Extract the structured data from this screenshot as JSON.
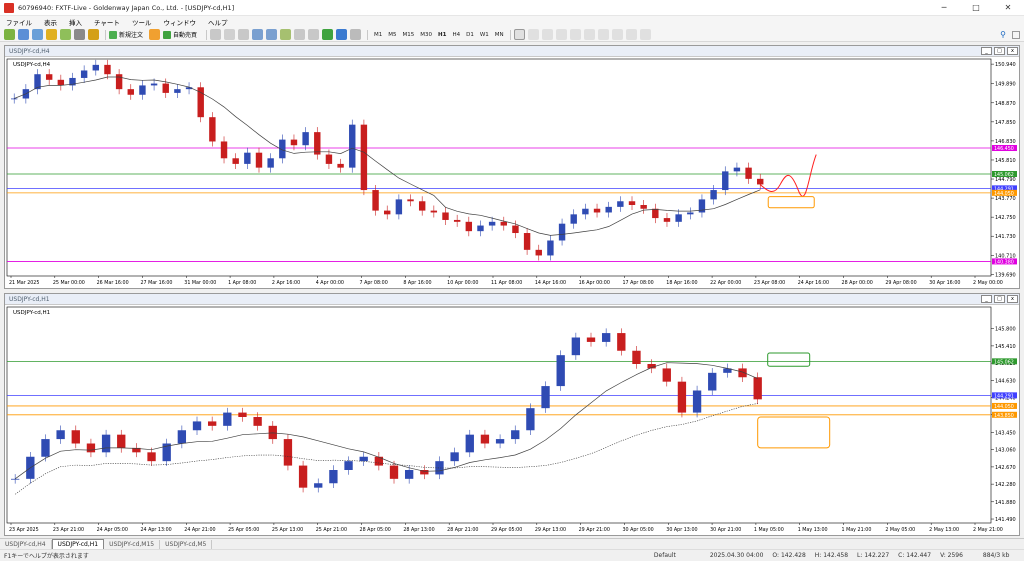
{
  "window": {
    "title": "60796940: FXTF-Live - Goldenway Japan Co., Ltd. - [USDJPY-cd,H1]"
  },
  "menu": [
    "ファイル",
    "表示",
    "挿入",
    "チャート",
    "ツール",
    "ウィンドウ",
    "ヘルプ"
  ],
  "toolbar": {
    "new_order": "新規注文",
    "auto_trade": "自動売買",
    "timeframes": [
      "M1",
      "M5",
      "M15",
      "M30",
      "H1",
      "H4",
      "D1",
      "W1",
      "MN"
    ],
    "active_timeframe": "H1"
  },
  "charts": [
    {
      "title": "USDJPY-cd,H4",
      "label": "USDJPY-cd,H4",
      "price_min": 139.6,
      "price_max": 151.0,
      "ticks": [
        "150.940",
        "149.890",
        "148.870",
        "147.850",
        "146.830",
        "145.810",
        "144.790",
        "143.770",
        "142.750",
        "141.730",
        "140.710",
        "139.690"
      ],
      "tick_values": [
        150.94,
        149.89,
        148.87,
        147.85,
        146.83,
        145.81,
        144.79,
        143.77,
        142.75,
        141.73,
        140.71,
        139.69
      ],
      "dates": [
        "21 Mar 2025",
        "25 Mar 00:00",
        "26 Mar 16:00",
        "27 Mar 16:00",
        "31 Mar 00:00",
        "1 Apr 08:00",
        "2 Apr 16:00",
        "4 Apr 00:00",
        "7 Apr 08:00",
        "8 Apr 16:00",
        "10 Apr 00:00",
        "11 Apr 08:00",
        "14 Apr 16:00",
        "16 Apr 00:00",
        "17 Apr 08:00",
        "18 Apr 16:00",
        "22 Apr 00:00",
        "23 Apr 08:00",
        "24 Apr 16:00",
        "28 Apr 00:00",
        "29 Apr 08:00",
        "30 Apr 16:00",
        "2 May 00:00"
      ],
      "hlines": [
        {
          "value": 146.45,
          "color": "#e000e0",
          "label": "146.450"
        },
        {
          "value": 145.06,
          "color": "#2e9a2e",
          "label": "145.062"
        },
        {
          "value": 144.29,
          "color": "#4040ff",
          "label": "144.291"
        },
        {
          "value": 144.05,
          "color": "#ff9900",
          "label": "144.050"
        },
        {
          "value": 140.38,
          "color": "#e000e0",
          "label": "140.380"
        }
      ],
      "closes": [
        149.1,
        149.6,
        150.4,
        150.1,
        149.8,
        150.2,
        150.6,
        150.9,
        150.4,
        149.6,
        149.3,
        149.8,
        149.9,
        149.4,
        149.6,
        149.7,
        148.1,
        146.8,
        145.9,
        145.6,
        146.2,
        145.4,
        145.9,
        146.9,
        146.6,
        147.3,
        146.1,
        145.6,
        145.4,
        147.7,
        144.2,
        143.1,
        142.9,
        143.7,
        143.6,
        143.1,
        143.0,
        142.6,
        142.5,
        142.0,
        142.3,
        142.5,
        142.3,
        141.9,
        141.0,
        140.7,
        141.5,
        142.4,
        142.9,
        143.2,
        143.0,
        143.3,
        143.6,
        143.4,
        143.2,
        142.7,
        142.5,
        142.9,
        143.0,
        143.7,
        144.2,
        145.2,
        145.4,
        144.8,
        144.5
      ],
      "path_color": "#ff2020",
      "box": {
        "y_hi": 143.85,
        "y_lo": 143.25,
        "color": "#ff9900"
      }
    },
    {
      "title": "USDJPY-cd,H1",
      "label": "USDJPY-cd,H1",
      "price_min": 141.4,
      "price_max": 146.2,
      "ticks": [
        "145.800",
        "145.410",
        "145.020",
        "144.630",
        "144.240",
        "143.850",
        "143.450",
        "143.060",
        "142.670",
        "142.280",
        "141.880",
        "141.490"
      ],
      "tick_values": [
        145.8,
        145.41,
        145.02,
        144.63,
        144.24,
        143.85,
        143.45,
        143.06,
        142.67,
        142.28,
        141.88,
        141.49
      ],
      "dates": [
        "23 Apr 2025",
        "23 Apr 21:00",
        "24 Apr 05:00",
        "24 Apr 13:00",
        "24 Apr 21:00",
        "25 Apr 05:00",
        "25 Apr 13:00",
        "25 Apr 21:00",
        "28 Apr 05:00",
        "28 Apr 13:00",
        "28 Apr 21:00",
        "29 Apr 05:00",
        "29 Apr 13:00",
        "29 Apr 21:00",
        "30 Apr 05:00",
        "30 Apr 13:00",
        "30 Apr 21:00",
        "1 May 05:00",
        "1 May 13:00",
        "1 May 21:00",
        "2 May 05:00",
        "2 May 13:00",
        "2 May 21:00"
      ],
      "hlines": [
        {
          "value": 145.06,
          "color": "#2e9a2e",
          "label": "145.062"
        },
        {
          "value": 144.29,
          "color": "#4040ff",
          "label": "144.291"
        },
        {
          "value": 144.05,
          "color": "#ff9900",
          "label": "144.050"
        },
        {
          "value": 143.85,
          "color": "#ff9900",
          "label": "143.850"
        }
      ],
      "closes": [
        142.4,
        142.9,
        143.3,
        143.5,
        143.2,
        143.0,
        143.4,
        143.1,
        143.0,
        142.8,
        143.2,
        143.5,
        143.7,
        143.6,
        143.9,
        143.8,
        143.6,
        143.3,
        142.7,
        142.2,
        142.3,
        142.6,
        142.8,
        142.9,
        142.7,
        142.4,
        142.6,
        142.5,
        142.8,
        143.0,
        143.4,
        143.2,
        143.3,
        143.5,
        144.0,
        144.5,
        145.2,
        145.6,
        145.5,
        145.7,
        145.3,
        145.0,
        144.9,
        144.6,
        143.9,
        144.4,
        144.8,
        144.9,
        144.7,
        144.2
      ],
      "green_box": {
        "y_hi": 145.25,
        "y_lo": 144.95
      },
      "orange_box": {
        "y_hi": 143.8,
        "y_lo": 143.1
      }
    }
  ],
  "tabs": [
    "USDJPY-cd,H4",
    "USDJPY-cd,H1",
    "USDJPY-cd,M15",
    "USDJPY-cd,M5"
  ],
  "active_tab": "USDJPY-cd,H1",
  "status": {
    "help": "F1キーでヘルプが表示されます",
    "profile": "Default",
    "datetime": "2025.04.30 04:00",
    "open": "O: 142.428",
    "high": "H: 142.458",
    "low": "L: 142.227",
    "close": "C: 142.447",
    "volume": "V: 2596",
    "traffic": "884/3 kb"
  },
  "colors": {
    "bull": "#2f4bb3",
    "bear": "#c81e1e",
    "ma": "#404040"
  }
}
